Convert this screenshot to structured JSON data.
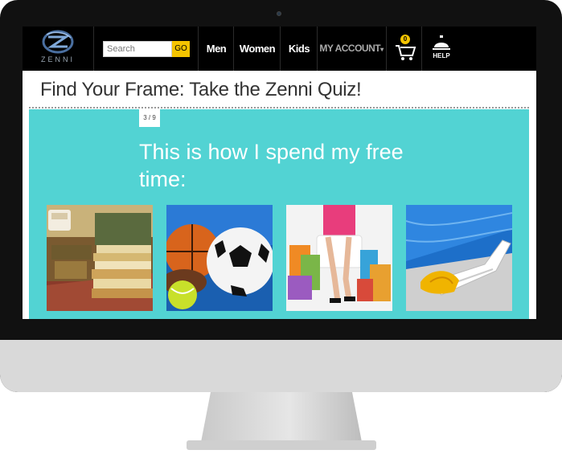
{
  "header": {
    "logo_text": "ZENNI",
    "search": {
      "placeholder": "Search",
      "value": "",
      "button_label": "GO"
    },
    "nav": [
      {
        "label": "Men"
      },
      {
        "label": "Women"
      },
      {
        "label": "Kids"
      },
      {
        "label": "MY ACCOUNT"
      }
    ],
    "cart_count": "0",
    "help_label": "HELP",
    "colors": {
      "accent": "#f5c400",
      "background": "#000000"
    }
  },
  "page": {
    "title": "Find Your Frame: Take the Zenni Quiz!"
  },
  "quiz": {
    "progress": "3 / 9",
    "question": "This is how I spend my free time:",
    "background_color": "#52d3d3",
    "options": [
      {
        "image": "books-and-tea"
      },
      {
        "image": "sports-balls"
      },
      {
        "image": "shopping-bags"
      },
      {
        "image": "pool-lounge-chair"
      }
    ]
  }
}
